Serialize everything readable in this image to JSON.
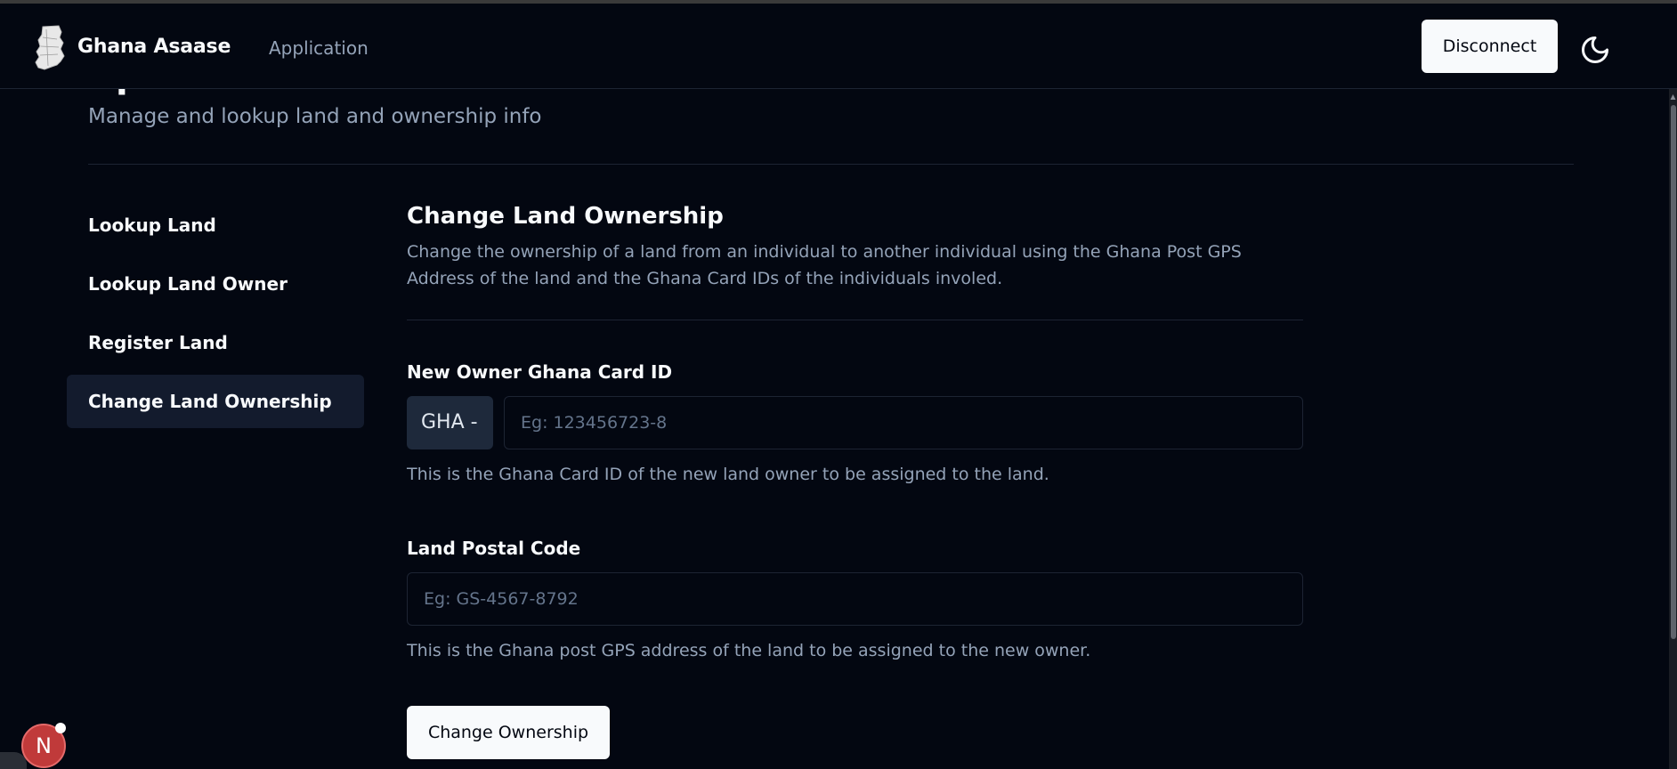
{
  "header": {
    "brand": "Ghana Asaase",
    "nav_application": "Application",
    "disconnect_label": "Disconnect",
    "theme_icon": "moon-icon"
  },
  "page": {
    "heading_partial": "Ap",
    "subtitle": "Manage and lookup land and ownership info"
  },
  "sidebar": {
    "items": [
      {
        "label": "Lookup Land",
        "active": false
      },
      {
        "label": "Lookup Land Owner",
        "active": false
      },
      {
        "label": "Register Land",
        "active": false
      },
      {
        "label": "Change Land Ownership",
        "active": true
      }
    ]
  },
  "form": {
    "title": "Change Land Ownership",
    "description": "Change the ownership of a land from an individual to another individual using the Ghana Post GPS Address of the land and the Ghana Card IDs of the individuals involed.",
    "new_owner": {
      "label": "New Owner Ghana Card ID",
      "prefix": "GHA -",
      "placeholder": "Eg: 123456723-8",
      "value": "",
      "hint": "This is the Ghana Card ID of the new land owner to be assigned to the land."
    },
    "postal_code": {
      "label": "Land Postal Code",
      "placeholder": "Eg: GS-4567-8792",
      "value": "",
      "hint": "This is the Ghana post GPS address of the land to be assigned to the new owner."
    },
    "submit_label": "Change Ownership"
  },
  "dev_badge": {
    "letter": "N"
  },
  "colors": {
    "background": "#030711",
    "muted_text": "#94a3b8",
    "border": "#1d2433",
    "active_item": "#131b2d",
    "button_bg": "#f8fafc",
    "badge_red": "#c03a3a"
  }
}
